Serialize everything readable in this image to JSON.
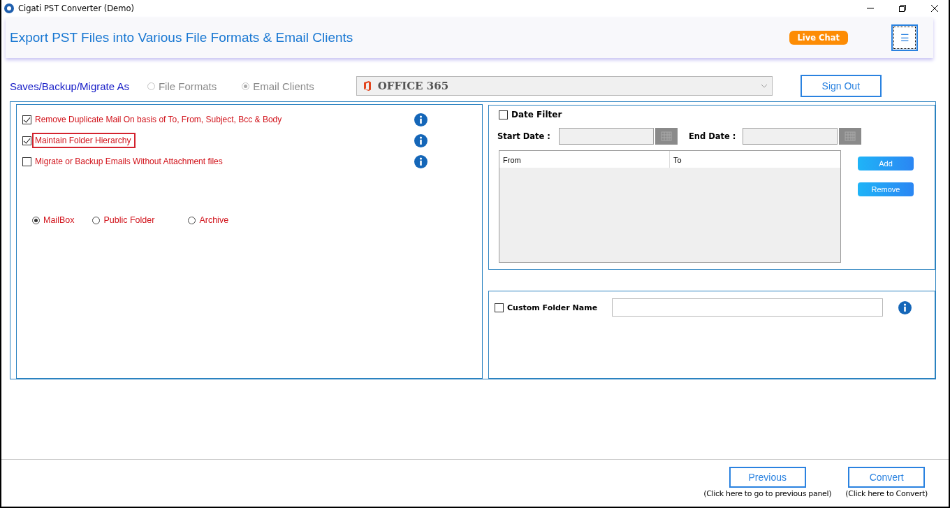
{
  "window": {
    "title": "Cigati PST Converter (Demo)"
  },
  "header": {
    "title": "Export PST Files into Various File Formats & Email Clients",
    "live_chat": "Live Chat",
    "menu_icon": "☰"
  },
  "save_as": {
    "label": "Saves/Backup/Migrate As",
    "modes": [
      {
        "label": "File Formats",
        "selected": false
      },
      {
        "label": "Email Clients",
        "selected": true
      }
    ],
    "target": "OFFICE 365",
    "sign_out": "Sign Out"
  },
  "options": [
    {
      "label": "Remove Duplicate Mail On basis of To, From, Subject, Bcc & Body",
      "checked": true,
      "highlighted": false
    },
    {
      "label": "Maintain Folder Hierarchy",
      "checked": true,
      "highlighted": true
    },
    {
      "label": "Migrate or Backup Emails Without Attachment files",
      "checked": false,
      "highlighted": false
    }
  ],
  "mailbox_types": [
    {
      "label": "MailBox",
      "selected": true
    },
    {
      "label": "Public Folder",
      "selected": false
    },
    {
      "label": "Archive",
      "selected": false
    }
  ],
  "date_filter": {
    "label": "Date Filter",
    "checked": false,
    "start_label": "Start Date :",
    "end_label": "End Date :",
    "columns": [
      "From",
      "To"
    ],
    "add": "Add",
    "remove": "Remove"
  },
  "custom_folder": {
    "label": "Custom Folder Name",
    "checked": false
  },
  "footer": [
    {
      "button": "Previous",
      "hint": "(Click here to go to previous panel)"
    },
    {
      "button": "Convert",
      "hint": "(Click here to Convert)"
    }
  ]
}
